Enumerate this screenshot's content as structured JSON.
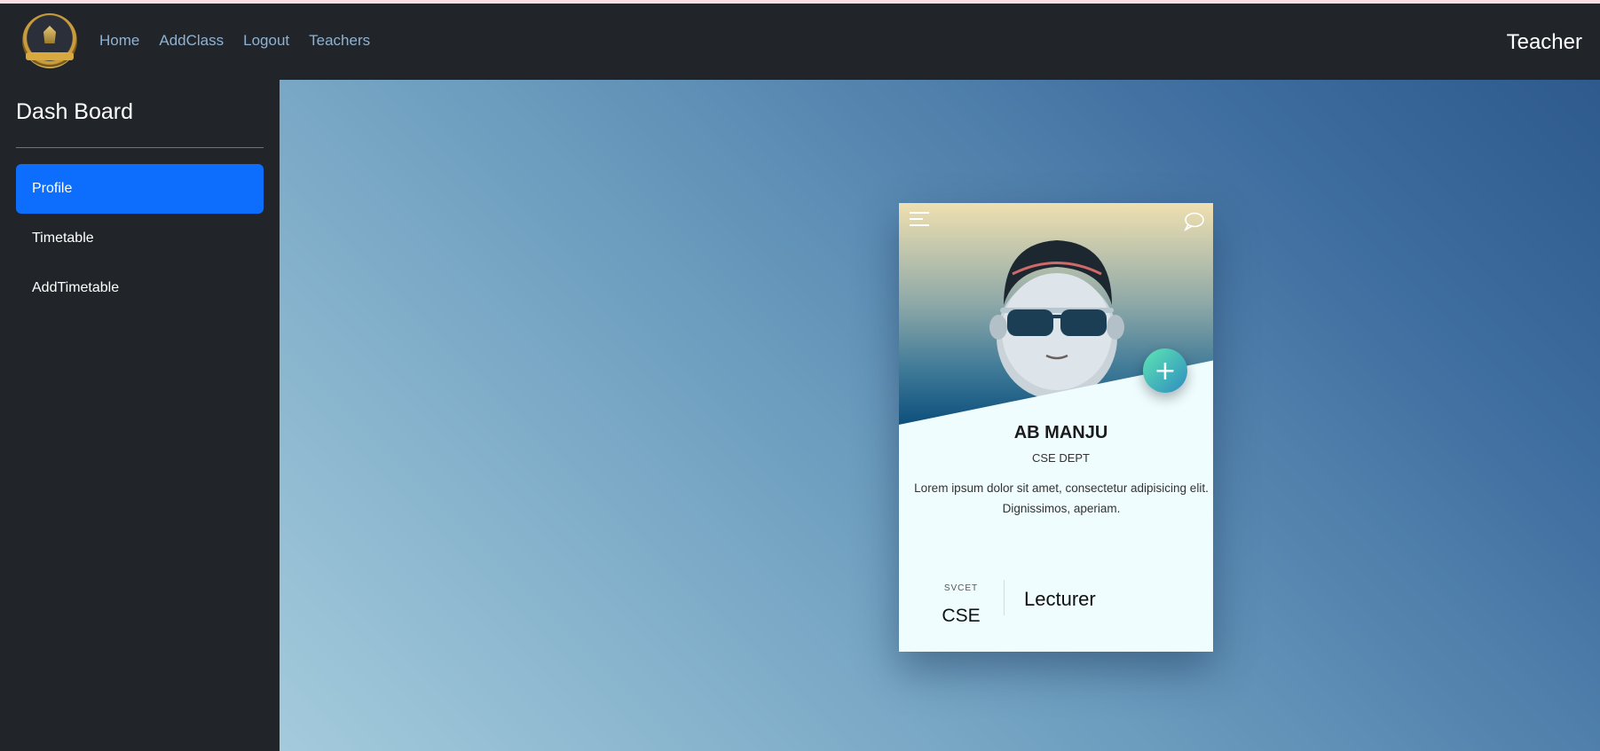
{
  "nav": {
    "links": [
      "Home",
      "AddClass",
      "Logout",
      "Teachers"
    ],
    "right_label": "Teacher"
  },
  "sidebar": {
    "title": "Dash Board",
    "items": [
      {
        "label": "Profile",
        "active": true
      },
      {
        "label": "Timetable",
        "active": false
      },
      {
        "label": "AddTimetable",
        "active": false
      }
    ]
  },
  "card": {
    "name": "AB MANJU",
    "dept": "CSE DEPT",
    "description": "Lorem ipsum dolor sit amet, consectetur adipisicing elit. Dignissimos, aperiam.",
    "stat_label": "SVCET",
    "stat_value": "CSE",
    "role": "Lecturer",
    "plus_glyph": "+"
  },
  "colors": {
    "navbar_bg": "#212529",
    "active_item": "#0d6efd",
    "nav_link": "#8fb2d3"
  },
  "icons": [
    "logo-emblem",
    "menu-icon",
    "chat-icon",
    "plus-icon",
    "avatar-image"
  ]
}
